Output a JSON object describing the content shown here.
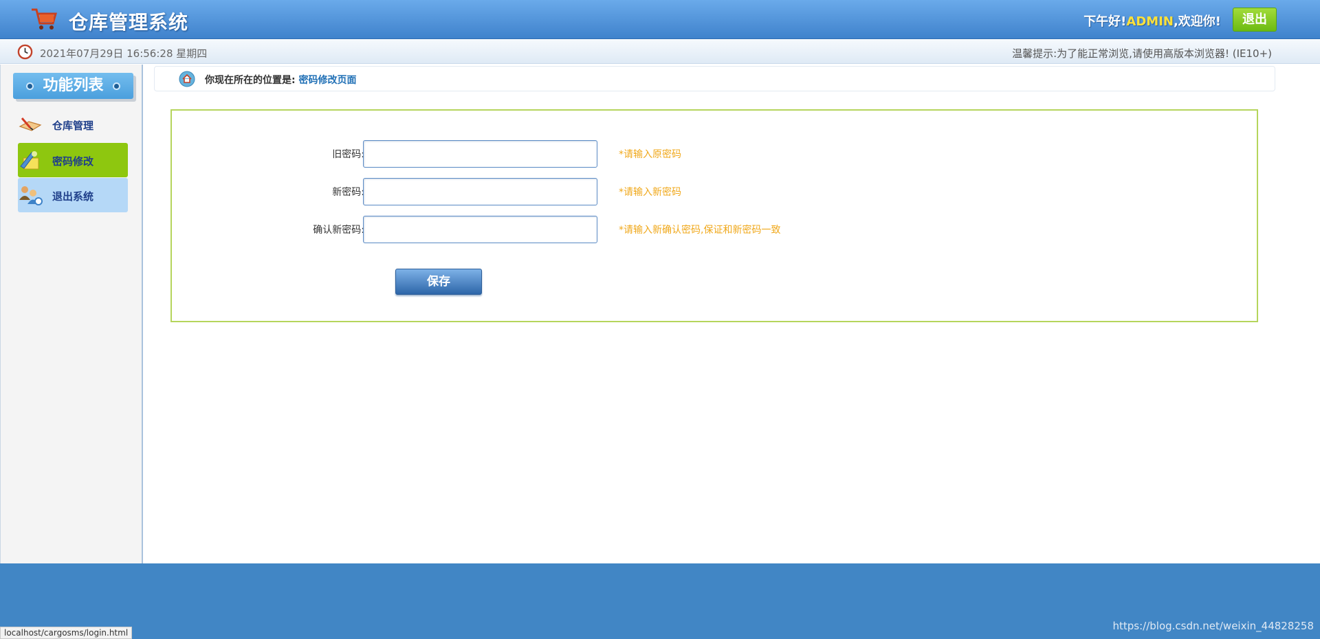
{
  "header": {
    "title": "仓库管理系统",
    "greeting_prefix": "下午好!",
    "username": "ADMIN",
    "greeting_suffix": ",欢迎你!",
    "logout_label": "退出",
    "icon": "shopping-cart-icon"
  },
  "infobar": {
    "datetime": "2021年07月29日 16:56:28 星期四",
    "tip": "温馨提示:为了能正常浏览,请使用高版本浏览器! (IE10+)",
    "icon": "clock-icon"
  },
  "sidebar": {
    "title": "功能列表",
    "items": [
      {
        "label": "仓库管理",
        "icon": "warehouse-icon"
      },
      {
        "label": "密码修改",
        "icon": "password-edit-icon"
      },
      {
        "label": "退出系统",
        "icon": "users-exit-icon"
      }
    ]
  },
  "breadcrumb": {
    "prefix": "你现在所在的位置是: ",
    "page": "密码修改页面"
  },
  "form": {
    "old_label": "旧密码:",
    "new_label": "新密码:",
    "confirm_label": "确认新密码:",
    "old_hint": "*请输入原密码",
    "new_hint": "*请输入新密码",
    "confirm_hint": "*请输入新确认密码,保证和新密码一致",
    "old_value": "",
    "new_value": "",
    "confirm_value": "",
    "save_label": "保存"
  },
  "footer": {
    "status_url": "localhost/cargosms/login.html",
    "watermark": "https://blog.csdn.net/weixin_44828258"
  },
  "colors": {
    "header": "#4a8fd6",
    "active_menu": "#8ec70f",
    "hover_menu": "#b5d8f7",
    "hint": "#f0a81b",
    "form_border": "#b5d55c",
    "footer": "#4186c5"
  }
}
